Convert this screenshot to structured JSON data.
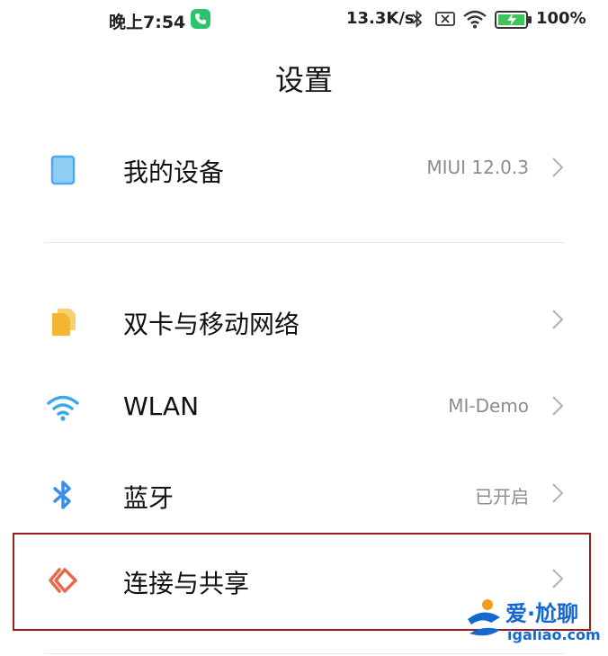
{
  "status_bar": {
    "time": "晚上7:54",
    "net_speed": "13.3K/s",
    "battery": "100%",
    "icons": [
      "phone-call-icon",
      "bluetooth-icon",
      "no-sim-icon",
      "wifi-icon",
      "battery-charging-icon"
    ]
  },
  "header": {
    "title": "设置"
  },
  "items": [
    {
      "label": "我的设备",
      "value": "MIUI 12.0.3",
      "icon": "device-icon",
      "icon_color": "#4da8f0"
    },
    {
      "label": "双卡与移动网络",
      "value": "",
      "icon": "sim-cards-icon",
      "icon_color": "#f5c542"
    },
    {
      "label": "WLAN",
      "value": "MI-Demo",
      "icon": "wifi-icon",
      "icon_color": "#3aa9e8"
    },
    {
      "label": "蓝牙",
      "value": "已开启",
      "icon": "bluetooth-icon",
      "icon_color": "#3a8fe8"
    },
    {
      "label": "连接与共享",
      "value": "",
      "icon": "connection-share-icon",
      "icon_color": "#e8694a"
    }
  ],
  "annotation": {
    "highlight_color": "#9b1d1d"
  },
  "watermark": {
    "main": "爱·尬聊",
    "url": "igaliao.com"
  }
}
